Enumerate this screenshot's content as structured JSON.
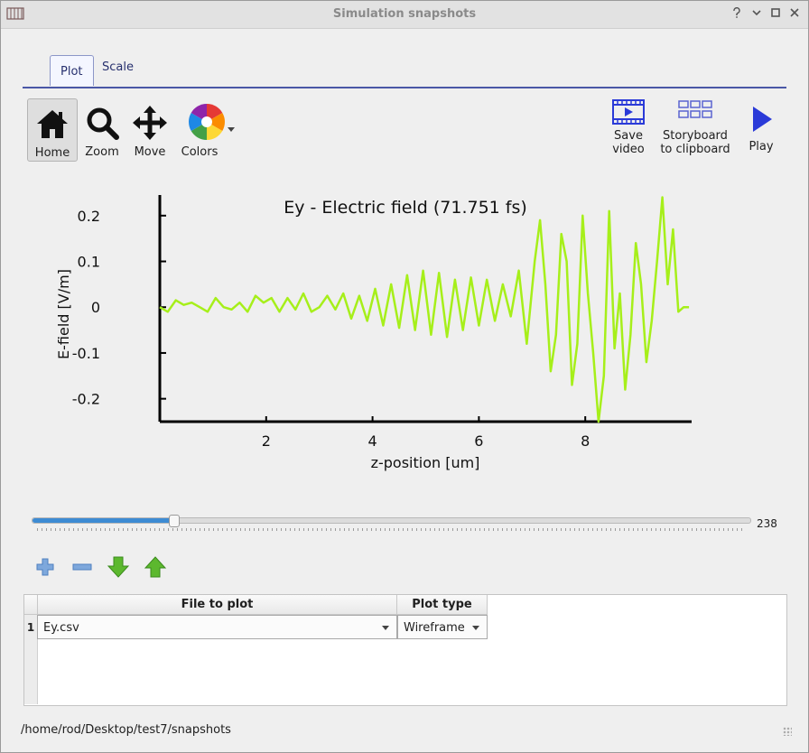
{
  "window": {
    "title": "Simulation snapshots"
  },
  "tabs": [
    {
      "label": "Plot"
    },
    {
      "label": "Scale"
    }
  ],
  "toolbar": {
    "home": "Home",
    "zoom": "Zoom",
    "move": "Move",
    "colors": "Colors",
    "save_video_1": "Save",
    "save_video_2": "video",
    "storyboard_1": "Storyboard",
    "storyboard_2": "to clipboard",
    "play": "Play"
  },
  "colors": {
    "series": "#a6ef1a",
    "accent": "#3d8bd3",
    "tab_border": "#4a57a6",
    "toolbar_blue": "#2a3ad8"
  },
  "chart_data": {
    "type": "line",
    "title": "Ey - Electric field (71.751 fs)",
    "xlabel": "z-position [um]",
    "ylabel": "E-field [V/m]",
    "xlim": [
      0,
      10
    ],
    "ylim": [
      -0.25,
      0.245
    ],
    "xticks": [
      "2",
      "4",
      "6",
      "8"
    ],
    "yticks": [
      "0.2",
      "0.1",
      "0",
      "-0.1",
      "-0.2"
    ],
    "series": [
      {
        "x": [
          0,
          0.15,
          0.3,
          0.45,
          0.6,
          0.75,
          0.9,
          1.05,
          1.2,
          1.35,
          1.5,
          1.65,
          1.8,
          1.95,
          2.1,
          2.25,
          2.4,
          2.55,
          2.7,
          2.85,
          3.0,
          3.15,
          3.3,
          3.45,
          3.6,
          3.75,
          3.9,
          4.05,
          4.2,
          4.35,
          4.5,
          4.65,
          4.8,
          4.95,
          5.1,
          5.25,
          5.4,
          5.55,
          5.7,
          5.85,
          6.0,
          6.15,
          6.3,
          6.45,
          6.6,
          6.75,
          6.9,
          7.05,
          7.15,
          7.25,
          7.35,
          7.45,
          7.55,
          7.65,
          7.75,
          7.85,
          7.95,
          8.05,
          8.15,
          8.25,
          8.35,
          8.45,
          8.55,
          8.65,
          8.75,
          8.85,
          8.95,
          9.05,
          9.15,
          9.25,
          9.35,
          9.45,
          9.55,
          9.65,
          9.75,
          9.85,
          9.95
        ],
        "y": [
          0,
          -0.01,
          0.015,
          0.005,
          0.01,
          0,
          -0.01,
          0.02,
          0,
          -0.005,
          0.01,
          -0.01,
          0.025,
          0.01,
          0.02,
          -0.01,
          0.02,
          -0.005,
          0.03,
          -0.01,
          0,
          0.025,
          -0.005,
          0.03,
          -0.025,
          0.025,
          -0.03,
          0.04,
          -0.04,
          0.05,
          -0.045,
          0.07,
          -0.05,
          0.08,
          -0.06,
          0.075,
          -0.065,
          0.06,
          -0.05,
          0.065,
          -0.04,
          0.06,
          -0.03,
          0.05,
          -0.02,
          0.08,
          -0.08,
          0.1,
          0.19,
          0.05,
          -0.14,
          -0.06,
          0.16,
          0.1,
          -0.17,
          -0.08,
          0.2,
          0.03,
          -0.1,
          -0.25,
          -0.15,
          0.21,
          -0.09,
          0.03,
          -0.18,
          -0.06,
          0.14,
          0.05,
          -0.12,
          -0.03,
          0.1,
          0.24,
          0.05,
          0.17,
          -0.01,
          0,
          0
        ]
      }
    ]
  },
  "slider": {
    "value": "238",
    "fraction": 0.196
  },
  "table": {
    "headers": [
      "File to plot",
      "Plot type"
    ],
    "rows": [
      {
        "num": "1",
        "file": "Ey.csv",
        "type": "Wireframe"
      }
    ]
  },
  "status": {
    "path": "/home/rod/Desktop/test7/snapshots"
  }
}
